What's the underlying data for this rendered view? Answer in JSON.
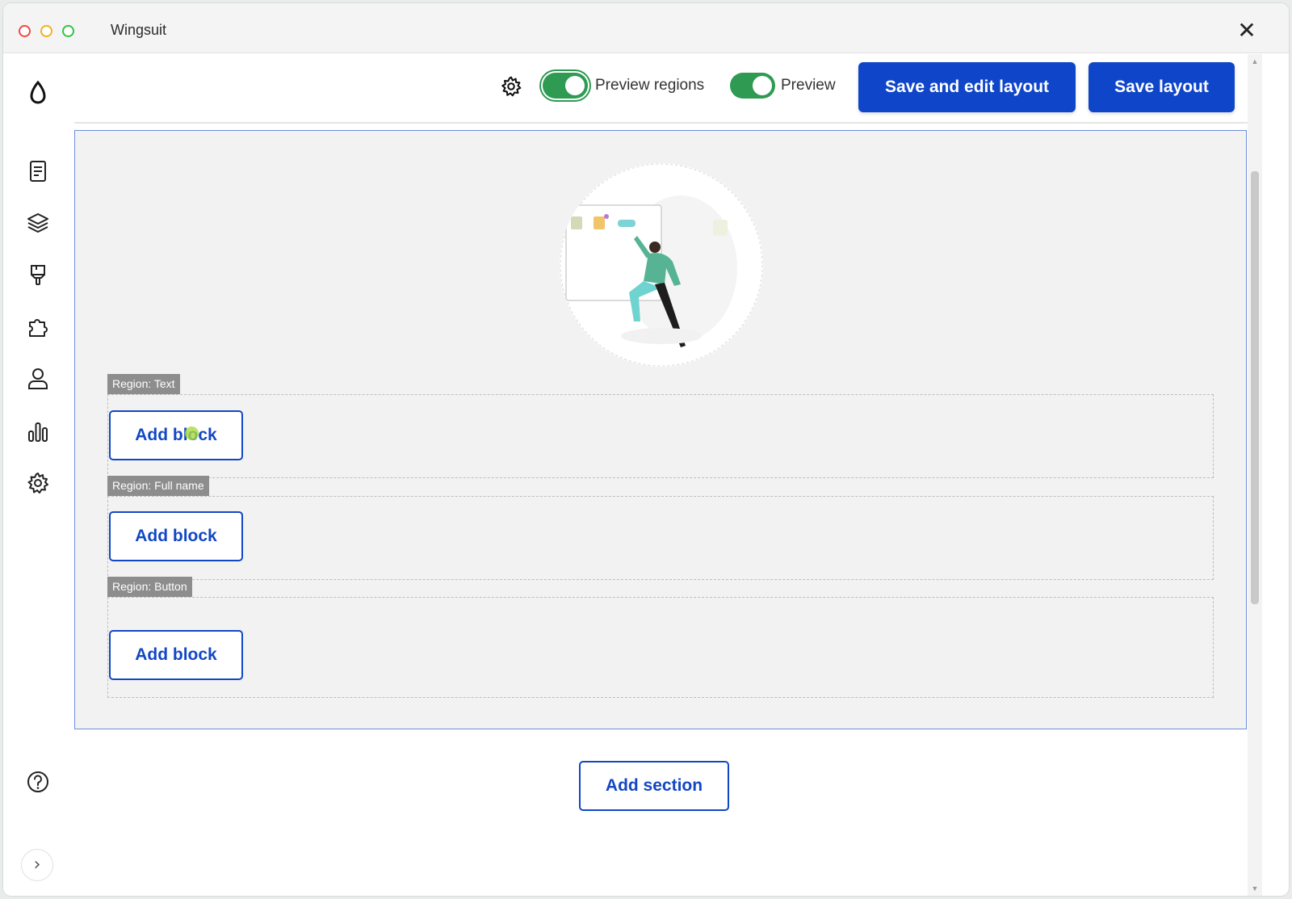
{
  "window": {
    "title": "Wingsuit",
    "close_glyph": "✕"
  },
  "sidebar": {
    "icons": [
      "drupal-logo-icon",
      "content-icon",
      "layers-icon",
      "brush-icon",
      "extend-icon",
      "people-icon",
      "reports-icon",
      "settings-icon"
    ],
    "help_icon": "help-icon",
    "expand_glyph": "›"
  },
  "toolbar": {
    "preview_regions_label": "Preview regions",
    "preview_regions_on": true,
    "preview_label": "Preview",
    "preview_on": true,
    "save_edit_label": "Save and edit layout",
    "save_label": "Save layout"
  },
  "regions": [
    {
      "tag": "Region: Text",
      "button": "Add block"
    },
    {
      "tag": "Region: Full name",
      "button": "Add block"
    },
    {
      "tag": "Region: Button",
      "button": "Add block"
    }
  ],
  "add_section_label": "Add section",
  "colors": {
    "primary": "#0f45c8",
    "toggle": "#2e9a52",
    "region_tag": "#8d8d8d"
  }
}
